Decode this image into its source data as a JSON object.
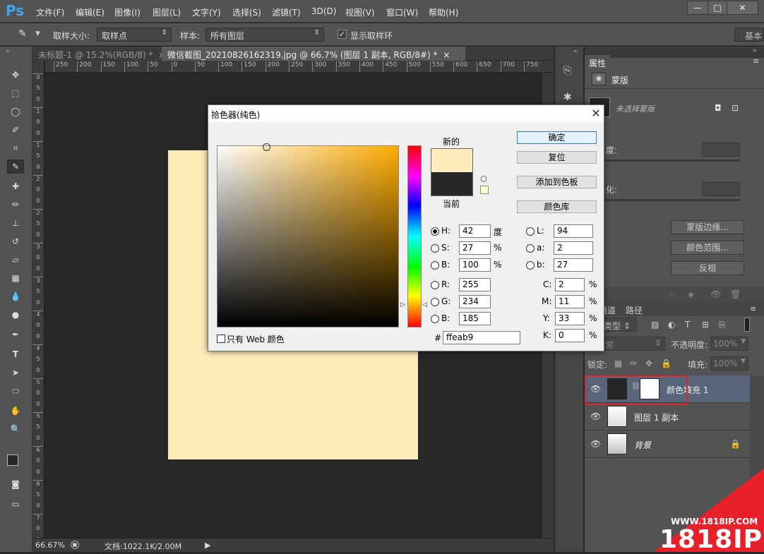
{
  "app": {
    "logo": "Ps",
    "menu": [
      "文件(F)",
      "编辑(E)",
      "图像(I)",
      "图层(L)",
      "文字(Y)",
      "选择(S)",
      "滤镜(T)",
      "3D(D)",
      "视图(V)",
      "窗口(W)",
      "帮助(H)"
    ],
    "window_buttons": {
      "minimize": "—",
      "restore": "□",
      "close": "✕"
    }
  },
  "options_bar": {
    "sample_size_label": "取样大小:",
    "sample_size_value": "取样点",
    "sample_label": "样本:",
    "sample_value": "所有图层",
    "show_ring_label": "显示取样环",
    "show_ring_checked": true,
    "workspace": "基本"
  },
  "doc_tabs": [
    {
      "label": "未标题-1 @ 15.2%(RGB/8) *",
      "close": "×",
      "active": false
    },
    {
      "label": "微信截图_20210826162319.jpg @ 66.7% (图层 1 副本, RGB/8#) *",
      "close": "×",
      "active": true
    }
  ],
  "ruler": {
    "h_ticks": [
      "250",
      "200",
      "150",
      "100",
      "50",
      "0",
      "50",
      "100",
      "150",
      "200",
      "250",
      "300",
      "350",
      "400",
      "450",
      "500",
      "550",
      "600",
      "650",
      "700",
      "750"
    ],
    "v_ticks": [
      "0",
      "5",
      "0",
      "1",
      "0",
      "0",
      "1",
      "5",
      "0",
      "2",
      "0",
      "0",
      "2",
      "5",
      "0",
      "3",
      "0",
      "0",
      "3",
      "5",
      "0",
      "4",
      "0",
      "0",
      "4",
      "5",
      "0",
      "5",
      "0",
      "0",
      "5",
      "5",
      "0",
      "6",
      "0",
      "0",
      "6",
      "5",
      "0",
      "7",
      "0",
      "0"
    ]
  },
  "status_bar": {
    "zoom": "66.67%",
    "doc": "文档:1022.1K/2.00M"
  },
  "canvas": {
    "fill_color": "#ffeab9"
  },
  "properties_panel": {
    "tab": "属性",
    "section": "蒙版",
    "mask_status": "未选择蒙版",
    "density_label": "度:",
    "feather_label": "化:",
    "btn_mask_edge": "蒙版边缘...",
    "btn_color_range": "颜色范围...",
    "btn_invert": "反相"
  },
  "layers_panel": {
    "tabs": [
      "通道",
      "路径"
    ],
    "filter_label": "类型",
    "blend_mode": "常",
    "opacity_label": "不透明度:",
    "opacity_value": "100%",
    "lock_label": "锁定:",
    "fill_label": "填充:",
    "fill_value": "100%",
    "layers": [
      {
        "name": "颜色填充 1",
        "selected": true
      },
      {
        "name": "图层 1 副本",
        "selected": false
      },
      {
        "name": "背景",
        "selected": false,
        "locked": true
      }
    ]
  },
  "color_picker": {
    "title": "拾色器(纯色)",
    "close": "✕",
    "new_label": "新的",
    "current_label": "当前",
    "new_color": "#ffeab9",
    "current_color": "#262626",
    "buttons": {
      "ok": "确定",
      "reset": "复位",
      "add_to_swatches": "添加到色板",
      "color_libraries": "颜色库"
    },
    "hsb": {
      "H": "42",
      "S": "27",
      "B": "100",
      "h_unit": "度",
      "pct": "%"
    },
    "rgb": {
      "R": "255",
      "G": "234",
      "B": "185"
    },
    "lab": {
      "L": "94",
      "a": "2",
      "b": "27"
    },
    "cmyk": {
      "C": "2",
      "M": "11",
      "Y": "33",
      "K": "0",
      "pct": "%"
    },
    "hex_label": "#",
    "hex": "ffeab9",
    "web_only_label": "只有 Web 颜色"
  },
  "watermark": {
    "url": "WWW.1818IP.COM",
    "brand": "1818IP"
  }
}
